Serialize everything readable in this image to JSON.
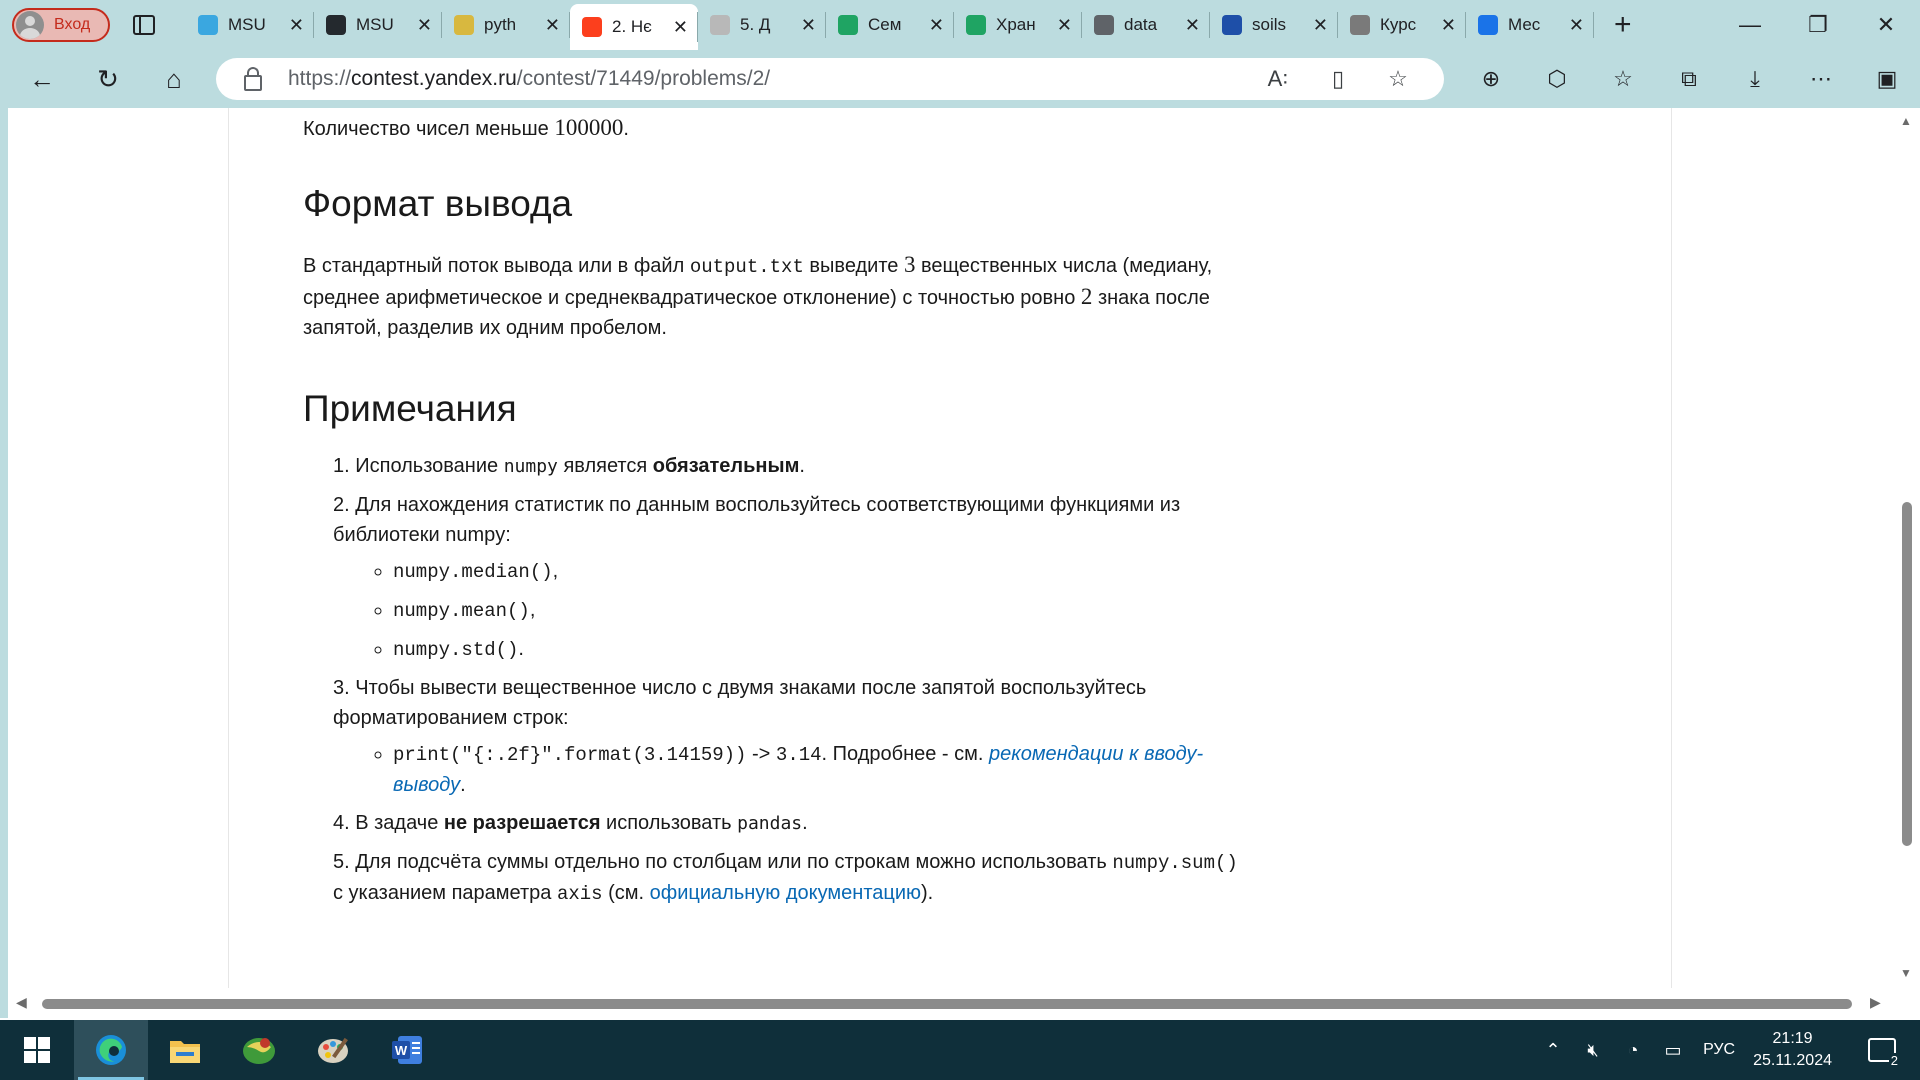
{
  "browser": {
    "profile_label": "Вход",
    "tabs": [
      {
        "title": "MSU",
        "icon": "telegram-icon",
        "color": "#3aa7e0"
      },
      {
        "title": "MSU",
        "icon": "github-icon",
        "color": "#24292e"
      },
      {
        "title": "pyth",
        "icon": "python-icon",
        "color": "#d8b83f"
      },
      {
        "title": "2. Нє",
        "icon": "yandex-icon",
        "color": "#fc3f1d",
        "active": true
      },
      {
        "title": "5. Д",
        "icon": "yandex-icon",
        "color": "#b8b8b8"
      },
      {
        "title": "Сем",
        "icon": "google-drive-icon",
        "color": "#1fa463"
      },
      {
        "title": "Хран",
        "icon": "google-drive-icon",
        "color": "#1fa463"
      },
      {
        "title": "data",
        "icon": "file-icon",
        "color": "#5f6368"
      },
      {
        "title": "soils",
        "icon": "table-icon",
        "color": "#1e4fa8"
      },
      {
        "title": "Курс",
        "icon": "grey-cloud-icon",
        "color": "#7a7a7a"
      },
      {
        "title": "Мес",
        "icon": "messenger-icon",
        "color": "#1a73e8"
      }
    ],
    "url_prefix": "https://",
    "url_host": "contest.yandex.ru",
    "url_path": "/contest/71449/problems/2/"
  },
  "problem": {
    "input_tail_text": "Количество чисел меньше ",
    "input_tail_num": "100000",
    "input_tail_end": ".",
    "output_heading": "Формат вывода",
    "output_p1": "В стандартный поток вывода или в файл ",
    "output_file": "output.txt",
    "output_p2": " выведите ",
    "output_n3": "3",
    "output_p3": " вещественных числа (медиану, среднее арифметическое и среднеквадратическое отклонение) с точностью ровно ",
    "output_n2": "2",
    "output_p4": " знака после запятой, разделив их одним пробелом.",
    "notes_heading": "Примечания",
    "note1_a": "1. Использование ",
    "note1_code": "numpy",
    "note1_b": " является ",
    "note1_bold": "обязательным",
    "note1_c": ".",
    "note2_a": "2. Для нахождения статистик по данным воспользуйтесь соответствующими функциями из библиотеки ",
    "note2_code": "numpy",
    "note2_b": ":",
    "note2_items": [
      "numpy.median()",
      "numpy.mean()",
      "numpy.std()"
    ],
    "note2_seps": [
      ",",
      ",",
      "."
    ],
    "note3_a": "3. Чтобы вывести вещественное число с двумя знаками после запятой воспользуйтесь форматированием строк:",
    "note3_code": "print(\"{:.2f}\".format(3.14159))",
    "note3_arrow": " -> ",
    "note3_result": "3.14",
    "note3_more": ". Подробнее - см. ",
    "note3_link": "рекомендации к вводу-выводу",
    "note3_end": ".",
    "note4_a": "4. В задаче ",
    "note4_bold": "не разрешается",
    "note4_b": " использовать ",
    "note4_code": "pandas",
    "note4_c": ".",
    "note5_a": "5. Для подсчёта суммы отдельно по столбцам или по строкам можно использовать ",
    "note5_code": "numpy.sum()",
    "note5_b": " с указанием параметра ",
    "note5_param": "axis",
    "note5_c": " (см. ",
    "note5_link": "официальную документацию",
    "note5_d": ")."
  },
  "taskbar": {
    "apps": [
      "edge-icon",
      "file-explorer-icon",
      "maps-icon",
      "paint-icon",
      "word-icon"
    ],
    "lang": "РУС",
    "time": "21:19",
    "date": "25.11.2024",
    "notifications": "2"
  }
}
